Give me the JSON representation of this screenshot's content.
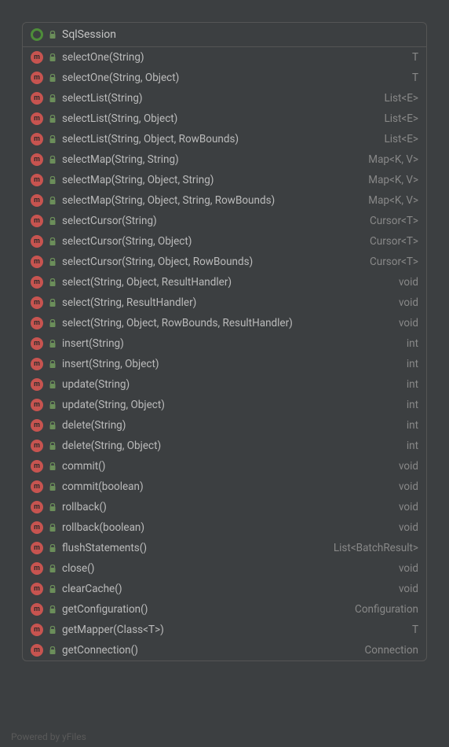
{
  "class_name": "SqlSession",
  "methods": [
    {
      "signature": "selectOne(String)",
      "returnType": "T"
    },
    {
      "signature": "selectOne(String, Object)",
      "returnType": "T"
    },
    {
      "signature": "selectList(String)",
      "returnType": "List<E>"
    },
    {
      "signature": "selectList(String, Object)",
      "returnType": "List<E>"
    },
    {
      "signature": "selectList(String, Object, RowBounds)",
      "returnType": "List<E>"
    },
    {
      "signature": "selectMap(String, String)",
      "returnType": "Map<K, V>"
    },
    {
      "signature": "selectMap(String, Object, String)",
      "returnType": "Map<K, V>"
    },
    {
      "signature": "selectMap(String, Object, String, RowBounds)",
      "returnType": "Map<K, V>"
    },
    {
      "signature": "selectCursor(String)",
      "returnType": "Cursor<T>"
    },
    {
      "signature": "selectCursor(String, Object)",
      "returnType": "Cursor<T>"
    },
    {
      "signature": "selectCursor(String, Object, RowBounds)",
      "returnType": "Cursor<T>"
    },
    {
      "signature": "select(String, Object, ResultHandler)",
      "returnType": "void"
    },
    {
      "signature": "select(String, ResultHandler)",
      "returnType": "void"
    },
    {
      "signature": "select(String, Object, RowBounds, ResultHandler)",
      "returnType": "void"
    },
    {
      "signature": "insert(String)",
      "returnType": "int"
    },
    {
      "signature": "insert(String, Object)",
      "returnType": "int"
    },
    {
      "signature": "update(String)",
      "returnType": "int"
    },
    {
      "signature": "update(String, Object)",
      "returnType": "int"
    },
    {
      "signature": "delete(String)",
      "returnType": "int"
    },
    {
      "signature": "delete(String, Object)",
      "returnType": "int"
    },
    {
      "signature": "commit()",
      "returnType": "void"
    },
    {
      "signature": "commit(boolean)",
      "returnType": "void"
    },
    {
      "signature": "rollback()",
      "returnType": "void"
    },
    {
      "signature": "rollback(boolean)",
      "returnType": "void"
    },
    {
      "signature": "flushStatements()",
      "returnType": "List<BatchResult>"
    },
    {
      "signature": "close()",
      "returnType": "void"
    },
    {
      "signature": "clearCache()",
      "returnType": "void"
    },
    {
      "signature": "getConfiguration()",
      "returnType": "Configuration"
    },
    {
      "signature": "getMapper(Class<T>)",
      "returnType": "T"
    },
    {
      "signature": "getConnection()",
      "returnType": "Connection"
    }
  ],
  "footer": "Powered by yFiles"
}
